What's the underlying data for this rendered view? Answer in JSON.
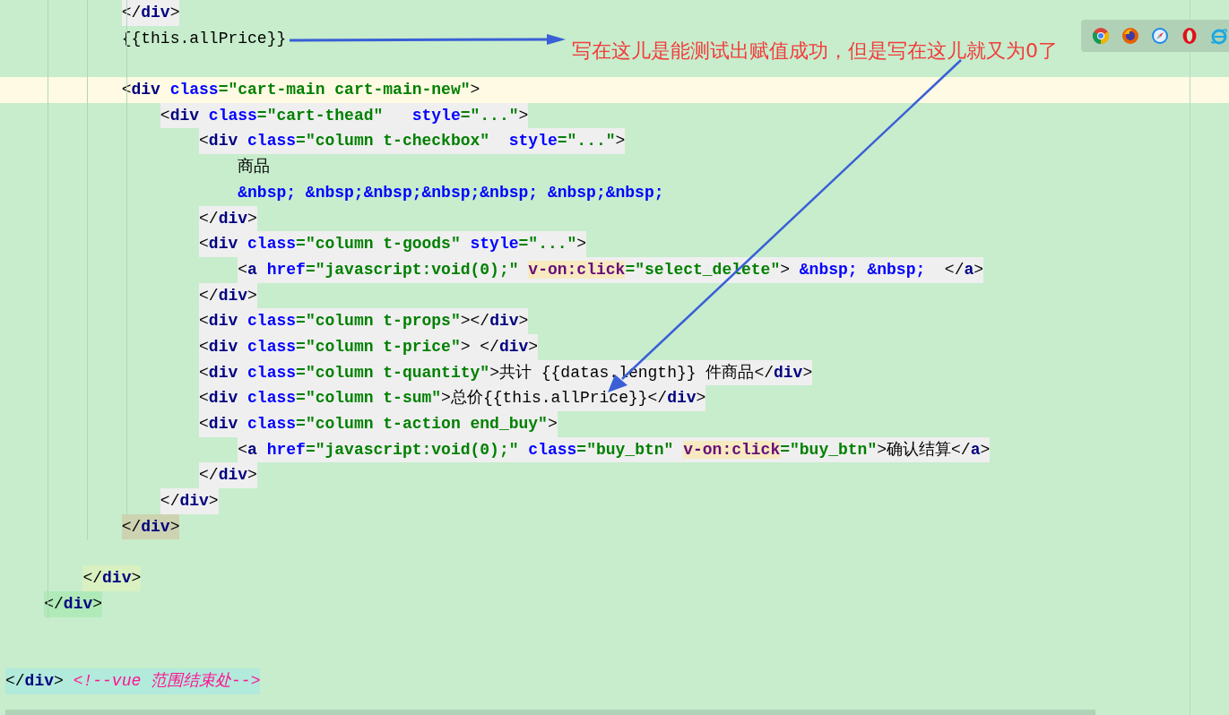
{
  "editor": {
    "lines": [
      {
        "kind": "tag-line",
        "tokens": [
          {
            "kind": "punct",
            "t": "            </"
          },
          {
            "kind": "tag",
            "t": "div"
          },
          {
            "kind": "punct",
            "t": ">"
          }
        ]
      },
      {
        "kind": "plain-line",
        "tokens": [
          {
            "kind": "text",
            "t": "            {{this.allPrice}}"
          }
        ]
      },
      {
        "kind": "blank"
      },
      {
        "kind": "current-line",
        "tokens": [
          {
            "kind": "punct",
            "t": "            <"
          },
          {
            "kind": "tag",
            "t": "div"
          },
          {
            "kind": "attr",
            "t": " class"
          },
          {
            "kind": "str",
            "t": "=\"cart-main cart-main-new\""
          },
          {
            "kind": "punct",
            "t": ">"
          }
        ]
      },
      {
        "kind": "tag-line",
        "tokens": [
          {
            "kind": "punct",
            "t": "                <"
          },
          {
            "kind": "tag",
            "t": "div"
          },
          {
            "kind": "attr",
            "t": " class"
          },
          {
            "kind": "str",
            "t": "=\"cart-thead\""
          },
          {
            "kind": "attr",
            "t": "   style"
          },
          {
            "kind": "str",
            "t": "=\"...\""
          },
          {
            "kind": "punct",
            "t": ">"
          }
        ]
      },
      {
        "kind": "tag-line",
        "tokens": [
          {
            "kind": "punct",
            "t": "                    <"
          },
          {
            "kind": "tag",
            "t": "div"
          },
          {
            "kind": "attr",
            "t": " class"
          },
          {
            "kind": "str",
            "t": "=\"column t-checkbox\""
          },
          {
            "kind": "attr",
            "t": "  style"
          },
          {
            "kind": "str",
            "t": "=\"...\""
          },
          {
            "kind": "punct",
            "t": ">"
          }
        ]
      },
      {
        "kind": "plain-line",
        "tokens": [
          {
            "kind": "text",
            "t": "                        商品"
          }
        ]
      },
      {
        "kind": "plain-line",
        "tokens": [
          {
            "kind": "entity",
            "t": "                        &nbsp; &nbsp;&nbsp;&nbsp;&nbsp; &nbsp;&nbsp;"
          }
        ]
      },
      {
        "kind": "tag-line",
        "tokens": [
          {
            "kind": "punct",
            "t": "                    </"
          },
          {
            "kind": "tag",
            "t": "div"
          },
          {
            "kind": "punct",
            "t": ">"
          }
        ]
      },
      {
        "kind": "tag-line",
        "tokens": [
          {
            "kind": "punct",
            "t": "                    <"
          },
          {
            "kind": "tag",
            "t": "div"
          },
          {
            "kind": "attr",
            "t": " class"
          },
          {
            "kind": "str",
            "t": "=\"column t-goods\""
          },
          {
            "kind": "attr",
            "t": " style"
          },
          {
            "kind": "str",
            "t": "=\"...\""
          },
          {
            "kind": "punct",
            "t": ">"
          }
        ]
      },
      {
        "kind": "tag-line",
        "tokens": [
          {
            "kind": "punct",
            "t": "                        <"
          },
          {
            "kind": "tag",
            "t": "a"
          },
          {
            "kind": "attr",
            "t": " href"
          },
          {
            "kind": "str",
            "t": "=\"javascript:void(0);\" "
          },
          {
            "kind": "vattr",
            "t": "v-on:click"
          },
          {
            "kind": "str",
            "t": "=\"select_delete\""
          },
          {
            "kind": "punct",
            "t": ">"
          },
          {
            "kind": "entity",
            "t": " &nbsp; &nbsp;  "
          },
          {
            "kind": "punct",
            "t": "</"
          },
          {
            "kind": "tag",
            "t": "a"
          },
          {
            "kind": "punct",
            "t": ">"
          }
        ]
      },
      {
        "kind": "tag-line",
        "tokens": [
          {
            "kind": "punct",
            "t": "                    </"
          },
          {
            "kind": "tag",
            "t": "div"
          },
          {
            "kind": "punct",
            "t": ">"
          }
        ]
      },
      {
        "kind": "tag-line",
        "tokens": [
          {
            "kind": "punct",
            "t": "                    <"
          },
          {
            "kind": "tag",
            "t": "div"
          },
          {
            "kind": "attr",
            "t": " class"
          },
          {
            "kind": "str",
            "t": "=\"column t-props\""
          },
          {
            "kind": "punct",
            "t": "></"
          },
          {
            "kind": "tag",
            "t": "div"
          },
          {
            "kind": "punct",
            "t": ">"
          }
        ]
      },
      {
        "kind": "tag-line",
        "tokens": [
          {
            "kind": "punct",
            "t": "                    <"
          },
          {
            "kind": "tag",
            "t": "div"
          },
          {
            "kind": "attr",
            "t": " class"
          },
          {
            "kind": "str",
            "t": "=\"column t-price\""
          },
          {
            "kind": "punct",
            "t": "> </"
          },
          {
            "kind": "tag",
            "t": "div"
          },
          {
            "kind": "punct",
            "t": ">"
          }
        ]
      },
      {
        "kind": "tag-line",
        "tokens": [
          {
            "kind": "punct",
            "t": "                    <"
          },
          {
            "kind": "tag",
            "t": "div"
          },
          {
            "kind": "attr",
            "t": " class"
          },
          {
            "kind": "str",
            "t": "=\"column t-quantity\""
          },
          {
            "kind": "punct",
            "t": ">"
          },
          {
            "kind": "text",
            "t": "共计 {{datas.length}} 件商品"
          },
          {
            "kind": "punct",
            "t": "</"
          },
          {
            "kind": "tag",
            "t": "div"
          },
          {
            "kind": "punct",
            "t": ">"
          }
        ]
      },
      {
        "kind": "tag-line",
        "tokens": [
          {
            "kind": "punct",
            "t": "                    <"
          },
          {
            "kind": "tag",
            "t": "div"
          },
          {
            "kind": "attr",
            "t": " class"
          },
          {
            "kind": "str",
            "t": "=\"column t-sum\""
          },
          {
            "kind": "punct",
            "t": ">"
          },
          {
            "kind": "text",
            "t": "总价{{this.allPrice}}"
          },
          {
            "kind": "punct",
            "t": "</"
          },
          {
            "kind": "tag",
            "t": "div"
          },
          {
            "kind": "punct",
            "t": ">"
          }
        ]
      },
      {
        "kind": "tag-line",
        "tokens": [
          {
            "kind": "punct",
            "t": "                    <"
          },
          {
            "kind": "tag",
            "t": "div"
          },
          {
            "kind": "attr",
            "t": " class"
          },
          {
            "kind": "str",
            "t": "=\"column t-action end_buy\""
          },
          {
            "kind": "punct",
            "t": ">"
          }
        ]
      },
      {
        "kind": "tag-line",
        "tokens": [
          {
            "kind": "punct",
            "t": "                        <"
          },
          {
            "kind": "tag",
            "t": "a"
          },
          {
            "kind": "attr",
            "t": " href"
          },
          {
            "kind": "str",
            "t": "=\"javascript:void(0);\""
          },
          {
            "kind": "attr",
            "t": " class"
          },
          {
            "kind": "str",
            "t": "=\"buy_btn\" "
          },
          {
            "kind": "vattr",
            "t": "v-on:click"
          },
          {
            "kind": "str",
            "t": "=\"buy_btn\""
          },
          {
            "kind": "punct",
            "t": ">"
          },
          {
            "kind": "text",
            "t": "确认结算"
          },
          {
            "kind": "punct",
            "t": "</"
          },
          {
            "kind": "tag",
            "t": "a"
          },
          {
            "kind": "punct",
            "t": ">"
          }
        ]
      },
      {
        "kind": "tag-line",
        "tokens": [
          {
            "kind": "punct",
            "t": "                    </"
          },
          {
            "kind": "tag",
            "t": "div"
          },
          {
            "kind": "punct",
            "t": ">"
          }
        ]
      },
      {
        "kind": "tag-line",
        "tokens": [
          {
            "kind": "punct",
            "t": "                </"
          },
          {
            "kind": "tag",
            "t": "div"
          },
          {
            "kind": "punct",
            "t": ">"
          }
        ]
      },
      {
        "kind": "match-line",
        "tokens": [
          {
            "kind": "punct",
            "t": "            </"
          },
          {
            "kind": "tag",
            "t": "div"
          },
          {
            "kind": "punct",
            "t": ">"
          }
        ]
      },
      {
        "kind": "blank"
      },
      {
        "kind": "outer-line",
        "tokens": [
          {
            "kind": "punct",
            "t": "        </"
          },
          {
            "kind": "tag",
            "t": "div"
          },
          {
            "kind": "punct",
            "t": ">"
          }
        ]
      },
      {
        "kind": "outer2-line",
        "tokens": [
          {
            "kind": "punct",
            "t": "    </"
          },
          {
            "kind": "tag",
            "t": "div"
          },
          {
            "kind": "punct",
            "t": ">"
          }
        ]
      },
      {
        "kind": "blank"
      },
      {
        "kind": "blank"
      },
      {
        "kind": "root-line",
        "tokens": [
          {
            "kind": "punct",
            "t": "</"
          },
          {
            "kind": "tag",
            "t": "div"
          },
          {
            "kind": "punct",
            "t": "> "
          },
          {
            "kind": "comment",
            "t": "<!--vue 范围结束处-->"
          }
        ]
      }
    ]
  },
  "annotation": {
    "text": "写在这儿是能测试出赋值成功，但是写在这儿就又为0了"
  },
  "browser_toolbar": {
    "icons": [
      {
        "kind": "chrome"
      },
      {
        "kind": "firefox"
      },
      {
        "kind": "safari"
      },
      {
        "kind": "opera"
      },
      {
        "kind": "ie"
      }
    ]
  }
}
